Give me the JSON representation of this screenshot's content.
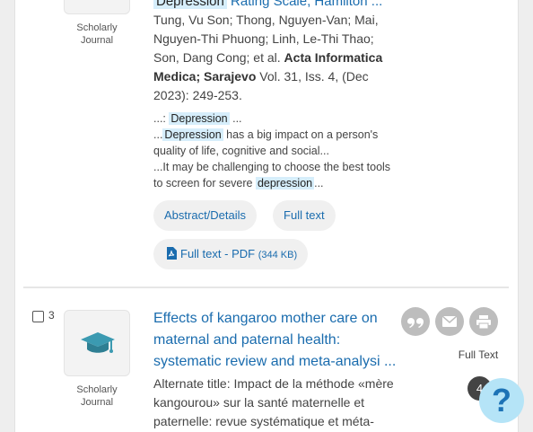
{
  "result1": {
    "pub_type_line1": "Scholarly",
    "pub_type_line2": "Journal",
    "title_highlight": "Depression",
    "title_rest": "Rating Scale, Hamilton ...",
    "authors": "Tung, Vu Son; Thong, Nguyen-Van; Mai, Nguyen-Thi Phuong; Linh, Le-Thi Thao; Son, Dang Cong; et al.",
    "source": "Acta Informatica Medica; Sarajevo",
    "volume": "Vol. 31, Iss. 4,",
    "date_pages": "(Dec 2023): 249-253.",
    "snippets": [
      {
        "pre": "...:",
        "hl": "Depression",
        "post": "..."
      },
      {
        "pre": "...",
        "hl": "Depression",
        "post": "has a big impact on a person's quality of life, cognitive and social..."
      },
      {
        "pre": "...It may be challenging to choose the best tools to screen for severe",
        "hl": "depression",
        "post": "..."
      }
    ],
    "links": {
      "abstract_details": "Abstract/Details",
      "full_text": "Full text",
      "full_text_pdf": "Full text - PDF",
      "pdf_size": "(344 KB)"
    }
  },
  "result2": {
    "number": "3",
    "pub_type_line1": "Scholarly",
    "pub_type_line2": "Journal",
    "title": "Effects of kangaroo mother care on maternal and paternal health: systematic review and meta-analysi ...",
    "alternate_title": "Alternate title: Impact de la méthode «mère kangourou» sur la santé maternelle et paternelle: revue systématique et méta-",
    "full_text_label": "Full Text"
  },
  "actions": {
    "cite_icon": "quote-icon",
    "email_icon": "envelope-icon",
    "print_icon": "printer-icon"
  },
  "help": {
    "badge_count": "4",
    "icon": "?"
  },
  "colors": {
    "link": "#1a6cae",
    "highlight": "#d6eefb",
    "action_button": "#bdbdbd",
    "help_bg": "#b5e4f7",
    "help_fg": "#1d73b6"
  }
}
